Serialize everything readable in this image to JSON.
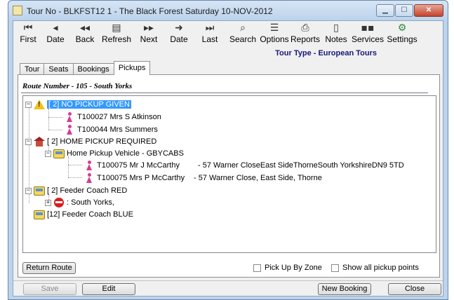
{
  "window": {
    "title": "Tour No -  BLKFST12 1  - The Black Forest   Saturday 10-NOV-2012",
    "minimize_glyph": "▁",
    "maximize_glyph": "☐",
    "close_glyph": "✕"
  },
  "toolbar": [
    {
      "label": "First",
      "icon": "first-icon",
      "glyph": "⏮"
    },
    {
      "label": "Date",
      "icon": "prev-date-icon",
      "glyph": "◂"
    },
    {
      "label": "Back",
      "icon": "back-icon",
      "glyph": "◂◂"
    },
    {
      "label": "Refresh",
      "icon": "refresh-icon",
      "glyph": "▤"
    },
    {
      "label": "Next",
      "icon": "next-icon",
      "glyph": "▸▸"
    },
    {
      "label": "Date",
      "icon": "next-date-icon",
      "glyph": "➜"
    },
    {
      "label": "Last",
      "icon": "last-icon",
      "glyph": "⏭"
    },
    {
      "label": "Search",
      "icon": "search-icon",
      "glyph": "⌕"
    },
    {
      "label": "Options",
      "icon": "options-icon",
      "glyph": "☰"
    },
    {
      "label": "Reports",
      "icon": "printer-icon",
      "glyph": "⎙"
    },
    {
      "label": "Notes",
      "icon": "notes-icon",
      "glyph": "▯"
    },
    {
      "label": "Services",
      "icon": "services-icon",
      "glyph": "▪▪"
    },
    {
      "label": "Settings",
      "icon": "settings-icon",
      "glyph": "⚙"
    }
  ],
  "tour_type": "Tour Type - European Tours",
  "tabs": [
    "Tour",
    "Seats",
    "Bookings",
    "Pickups"
  ],
  "active_tab": "Pickups",
  "route_title": "Route Number - 105 - South Yorks",
  "tree": {
    "no_pickup": {
      "label": "[ 2]  NO PICKUP GIVEN",
      "icon": "warning-icon"
    },
    "np_1": "T100027  Mrs S Atkinson",
    "np_2": "T100044  Mrs  Summers",
    "home_pickup": {
      "label": "[ 2]  HOME PICKUP REQUIRED",
      "icon": "house-icon"
    },
    "home_vehicle": "Home Pickup Vehicle - GBYCABS",
    "hp_1_name": "T100075  Mr J McCarthy",
    "hp_1_addr": "- 57 Warner CloseEast SideThorneSouth YorkshireDN9 5TD",
    "hp_2_name": "T100075  Mrs P McCarthy",
    "hp_2_addr": "- 57 Warner Close, East Side, Thorne",
    "feeder_red": "[ 2]  Feeder Coach RED",
    "south_yorks": ": South Yorks,",
    "feeder_blue": "[12]  Feeder Coach BLUE"
  },
  "buttons": {
    "return_route": "Return Route",
    "save": "Save",
    "edit": "Edit",
    "new_booking": "New Booking",
    "close": "Close"
  },
  "checkboxes": {
    "pick_up_by_zone": {
      "label": "Pick Up By Zone",
      "checked": false
    },
    "show_all_pickup_points": {
      "label": "Show all pickup points",
      "checked": false
    }
  },
  "colors": {
    "selection": "#3399ff",
    "tour_type": "#17177a",
    "person": "#d33d96"
  }
}
